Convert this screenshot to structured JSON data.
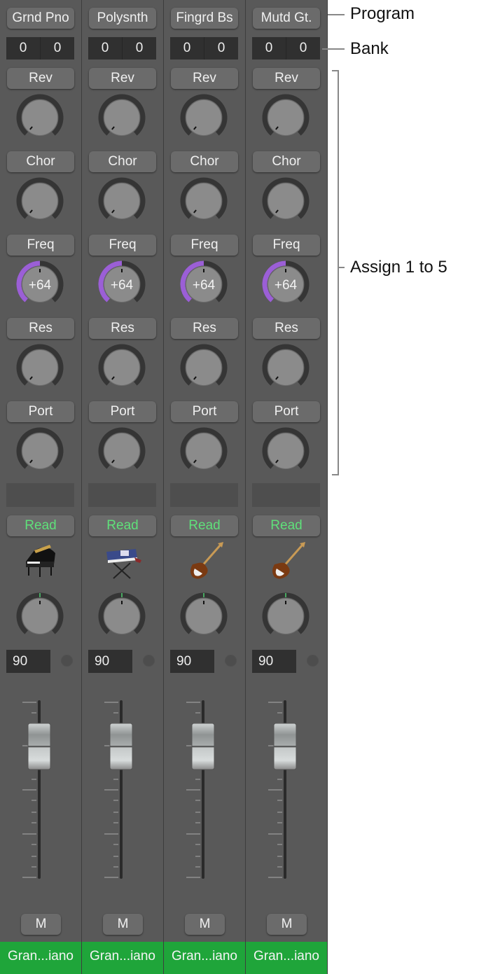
{
  "channels": [
    {
      "program": "Grnd Pno",
      "bank": [
        "0",
        "0"
      ],
      "assign": [
        {
          "label": "Rev"
        },
        {
          "label": "Chor"
        },
        {
          "label": "Freq",
          "value": "+64"
        },
        {
          "label": "Res"
        },
        {
          "label": "Port"
        }
      ],
      "automation": "Read",
      "icon": "grand-piano-icon",
      "volume": "90",
      "mute": "M",
      "name": "Gran...iano"
    },
    {
      "program": "Polysnth",
      "bank": [
        "0",
        "0"
      ],
      "assign": [
        {
          "label": "Rev"
        },
        {
          "label": "Chor"
        },
        {
          "label": "Freq",
          "value": "+64"
        },
        {
          "label": "Res"
        },
        {
          "label": "Port"
        }
      ],
      "automation": "Read",
      "icon": "synth-keyboard-icon",
      "volume": "90",
      "mute": "M",
      "name": "Gran...iano"
    },
    {
      "program": "Fingrd Bs",
      "bank": [
        "0",
        "0"
      ],
      "assign": [
        {
          "label": "Rev"
        },
        {
          "label": "Chor"
        },
        {
          "label": "Freq",
          "value": "+64"
        },
        {
          "label": "Res"
        },
        {
          "label": "Port"
        }
      ],
      "automation": "Read",
      "icon": "electric-guitar-icon",
      "volume": "90",
      "mute": "M",
      "name": "Gran...iano"
    },
    {
      "program": "Mutd Gt.",
      "bank": [
        "0",
        "0"
      ],
      "assign": [
        {
          "label": "Rev"
        },
        {
          "label": "Chor"
        },
        {
          "label": "Freq",
          "value": "+64"
        },
        {
          "label": "Res"
        },
        {
          "label": "Port"
        }
      ],
      "automation": "Read",
      "icon": "electric-guitar-icon",
      "volume": "90",
      "mute": "M",
      "name": "Gran...iano"
    }
  ],
  "annotations": {
    "program": "Program",
    "bank": "Bank",
    "assign": "Assign 1 to 5"
  },
  "colors": {
    "freq_arc": "#9b5fd6",
    "read_text": "#5fe07a",
    "track_name_bg": "#1fa53a"
  }
}
